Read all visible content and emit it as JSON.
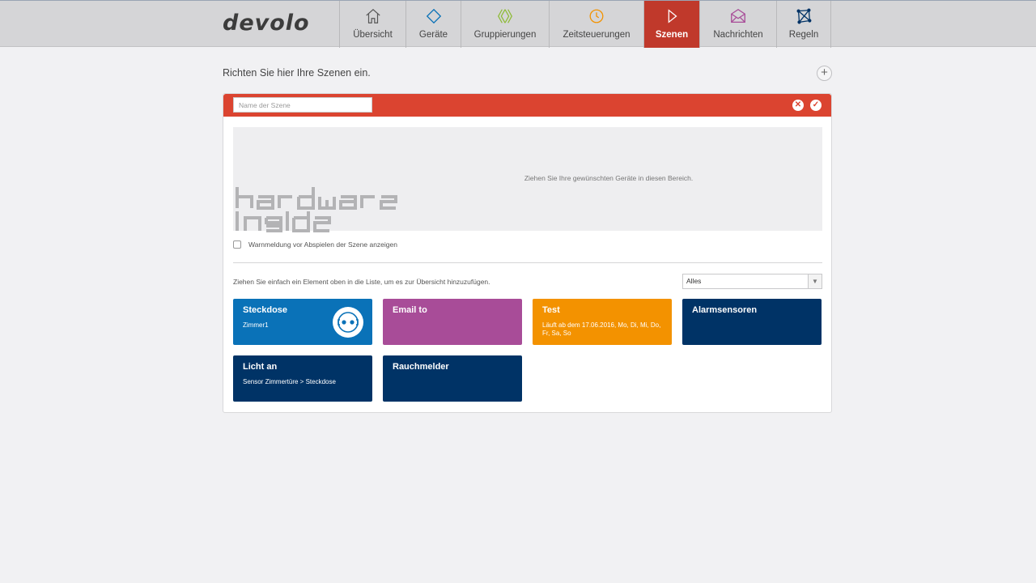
{
  "brand": "devolo",
  "nav": [
    {
      "label": "Übersicht",
      "icon": "home-icon"
    },
    {
      "label": "Geräte",
      "icon": "devices-icon"
    },
    {
      "label": "Gruppierungen",
      "icon": "groups-icon"
    },
    {
      "label": "Zeitsteuerungen",
      "icon": "clock-icon"
    },
    {
      "label": "Szenen",
      "icon": "play-icon",
      "active": true
    },
    {
      "label": "Nachrichten",
      "icon": "mail-icon"
    },
    {
      "label": "Regeln",
      "icon": "rules-icon"
    }
  ],
  "page": {
    "heading": "Richten Sie hier Ihre Szenen ein.",
    "add_label": "+"
  },
  "scene_editor": {
    "name_placeholder": "Name der Szene",
    "name_value": "",
    "drop_hint": "Ziehen Sie Ihre gewünschten Geräte in diesen Bereich.",
    "warning_label": "Warnmeldung vor Abspielen der Szene anzeigen",
    "warning_checked": false,
    "watermark": "hardware inside"
  },
  "list": {
    "hint": "Ziehen Sie einfach ein Element oben in die Liste, um es zur Übersicht hinzuzufügen.",
    "filter_value": "Alles"
  },
  "tiles": [
    {
      "title": "Steckdose",
      "sub": "Zimmer1",
      "color": "#0a72b8",
      "icon": "socket-icon"
    },
    {
      "title": "Email to",
      "sub": "",
      "color": "#a84c98"
    },
    {
      "title": "Test",
      "sub": "Läuft ab dem 17.06.2016, Mo, Di, Mi, Do, Fr, Sa, So",
      "color": "#f39200"
    },
    {
      "title": "Alarmsensoren",
      "sub": "",
      "color": "#003366"
    },
    {
      "title": "Licht an",
      "sub": "Sensor Zimmertüre > Steckdose",
      "color": "#003366"
    },
    {
      "title": "Rauchmelder",
      "sub": "",
      "color": "#003366"
    }
  ],
  "colors": {
    "accent_red": "#db4430",
    "nav_active": "#c0392b",
    "tile_blue": "#0a72b8",
    "tile_purple": "#a84c98",
    "tile_orange": "#f39200",
    "tile_navy": "#003366"
  }
}
